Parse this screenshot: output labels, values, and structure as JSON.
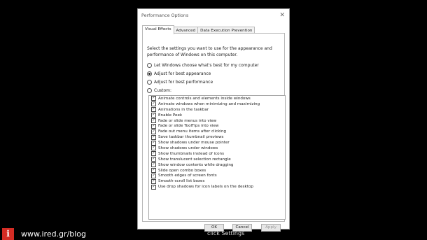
{
  "window": {
    "title": "Performance Options",
    "close_glyph": "✕"
  },
  "tabs": [
    "Visual Effects",
    "Advanced",
    "Data Execution Prevention"
  ],
  "intro_text": "Select the settings you want to use for the appearance and performance of Windows on this computer.",
  "radios": [
    {
      "label": "Let Windows choose what's best for my computer",
      "selected": false
    },
    {
      "label": "Adjust for best appearance",
      "selected": true
    },
    {
      "label": "Adjust for best performance",
      "selected": false
    },
    {
      "label": "Custom:",
      "selected": false
    }
  ],
  "effects": [
    {
      "label": "Animate controls and elements inside windows",
      "checked": true
    },
    {
      "label": "Animate windows when minimizing and maximizing",
      "checked": true
    },
    {
      "label": "Animations in the taskbar",
      "checked": true
    },
    {
      "label": "Enable Peek",
      "checked": true
    },
    {
      "label": "Fade or slide menus into view",
      "checked": true
    },
    {
      "label": "Fade or slide ToolTips into view",
      "checked": true
    },
    {
      "label": "Fade out menu items after clicking",
      "checked": true
    },
    {
      "label": "Save taskbar thumbnail previews",
      "checked": true
    },
    {
      "label": "Show shadows under mouse pointer",
      "checked": true
    },
    {
      "label": "Show shadows under windows",
      "checked": true
    },
    {
      "label": "Show thumbnails instead of icons",
      "checked": true
    },
    {
      "label": "Show translucent selection rectangle",
      "checked": true
    },
    {
      "label": "Show window contents while dragging",
      "checked": true
    },
    {
      "label": "Slide open combo boxes",
      "checked": true
    },
    {
      "label": "Smooth edges of screen fonts",
      "checked": true
    },
    {
      "label": "Smooth-scroll list boxes",
      "checked": true
    },
    {
      "label": "Use drop shadows for icon labels on the desktop",
      "checked": true
    }
  ],
  "buttons": {
    "ok": "OK",
    "cancel": "Cancel",
    "apply": "Apply"
  },
  "background_caption": "click Settings",
  "footer": {
    "logo_letter": "i",
    "site": "www.ired.gr/blog"
  }
}
